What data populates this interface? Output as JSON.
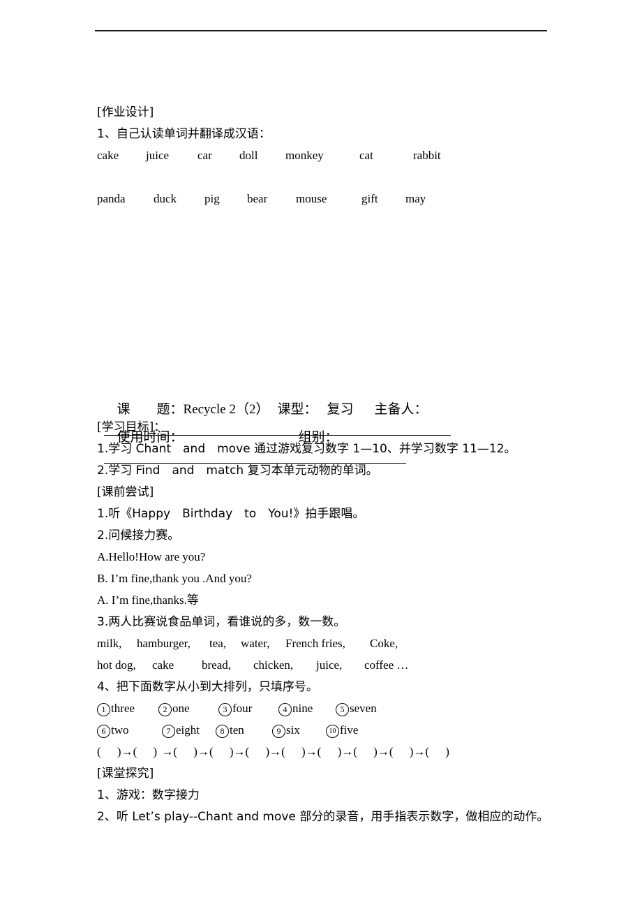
{
  "homework": {
    "heading": "[作业设计]",
    "task1": "1、自己认读单词并翻译成汉语：",
    "words_row1": [
      "cake",
      "juice",
      "car",
      "doll",
      "monkey",
      "cat",
      "rabbit"
    ],
    "words_row2": [
      "panda",
      "duck",
      "pig",
      "bear",
      "mouse",
      "gift",
      "may"
    ]
  },
  "lesson_header": {
    "topic_label": "课　　题：",
    "topic_value": "Recycle 2（2）",
    "type_label": "课型：",
    "type_value": "复习",
    "preparer_label": "主备人：",
    "time_label": "使用时间：",
    "group_label": "组别："
  },
  "objectives": {
    "heading": "[学习目标]：",
    "items": [
      "1.学习 Chant　and　move 通过游戏复习数字 1—10、并学习数字 11—12。",
      "2.学习 Find　and　match 复习本单元动物的单词。"
    ]
  },
  "pre_class": {
    "heading": "[课前尝试]",
    "item1": "1.听《Happy　Birthday　to　You!》拍手跟唱。",
    "item2": "2.问候接力赛。",
    "dialogue": [
      "A.Hello!How are you?",
      "B. I’m fine,thank you .And you?",
      "A. I’m fine,thanks.等"
    ],
    "item3": "3.两人比赛说食品单词，看谁说的多，数一数。",
    "food_row1": [
      "milk,",
      "hamburger,",
      "tea,",
      "water,",
      "French fries,",
      "Coke,"
    ],
    "food_row2": [
      "hot dog,",
      "cake",
      "bread,",
      "chicken,",
      "juice,",
      "coffee …"
    ],
    "item4": "4、把下面数字从小到大排列，只填序号。",
    "numbers_row1": [
      {
        "mark": "1",
        "word": "three"
      },
      {
        "mark": "2",
        "word": "one"
      },
      {
        "mark": "3",
        "word": "four"
      },
      {
        "mark": "4",
        "word": "nine"
      },
      {
        "mark": "5",
        "word": "seven"
      }
    ],
    "numbers_row2": [
      {
        "mark": "6",
        "word": "two"
      },
      {
        "mark": "7",
        "word": "eight"
      },
      {
        "mark": "8",
        "word": "ten"
      },
      {
        "mark": "9",
        "word": "six"
      },
      {
        "mark": "10",
        "word": "five"
      }
    ],
    "order_blanks": "(　 )→(　 ) →(　 )→(　 )→(　 )→(　 )→(　 )→(　 )→(　 )→(　 )"
  },
  "in_class": {
    "heading": "[课堂探究]",
    "item1": "1、游戏：数字接力",
    "item2": "2、听 Let’s play--Chant and move 部分的录音，用手指表示数字，做相应的动作。"
  }
}
